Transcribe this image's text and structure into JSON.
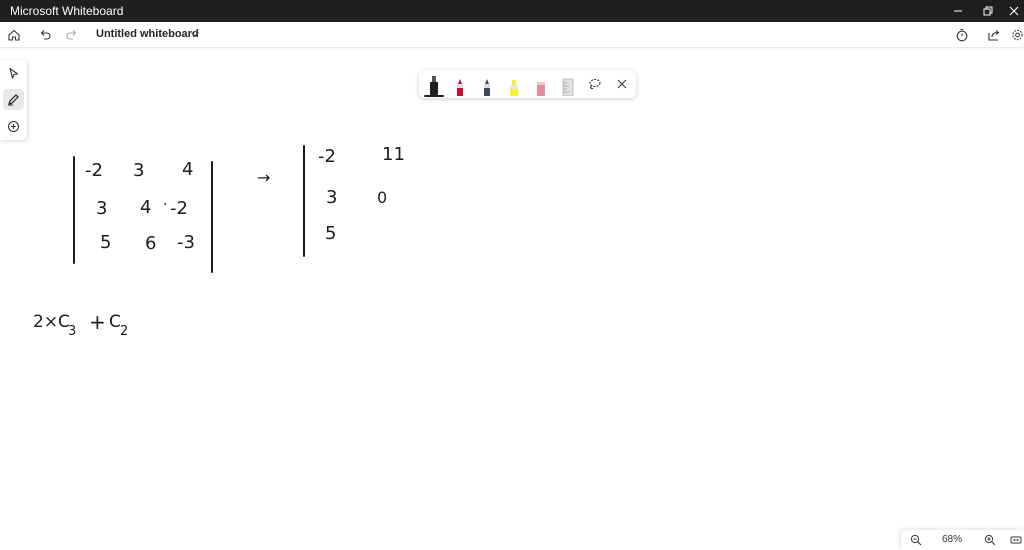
{
  "window": {
    "app_title": "Microsoft Whiteboard"
  },
  "appbar": {
    "board_title": "Untitled whiteboard"
  },
  "canvas": {
    "matrix_a": {
      "row1": [
        "-2",
        "3",
        "4"
      ],
      "row2": [
        "3",
        "4",
        "-2"
      ],
      "row3": [
        "5",
        "6",
        "-3"
      ]
    },
    "arrow": "→",
    "matrix_b": {
      "row1": [
        "-2",
        "11"
      ],
      "row2": [
        "3",
        "0"
      ],
      "row3": [
        "5"
      ]
    },
    "operation": {
      "coef": "2×C",
      "sub1": "3",
      "plus": "+",
      "c": "C",
      "sub2": "2"
    }
  },
  "zoom": {
    "level": "68%"
  },
  "colors": {
    "titlebar": "#1f1f1f",
    "pen_black": "#1f1f1f",
    "pen_red": "#c8102e",
    "pen_blue": "#3b4a5e",
    "highlighter": "#f7f03a"
  },
  "icons": [
    "home-icon",
    "undo-icon",
    "redo-icon",
    "chevron-down-icon",
    "timer-icon",
    "share-icon",
    "settings-icon",
    "select-icon",
    "pen-icon",
    "add-icon",
    "lasso-icon",
    "close-icon",
    "zoom-out-icon",
    "zoom-in-icon",
    "fit-screen-icon"
  ]
}
